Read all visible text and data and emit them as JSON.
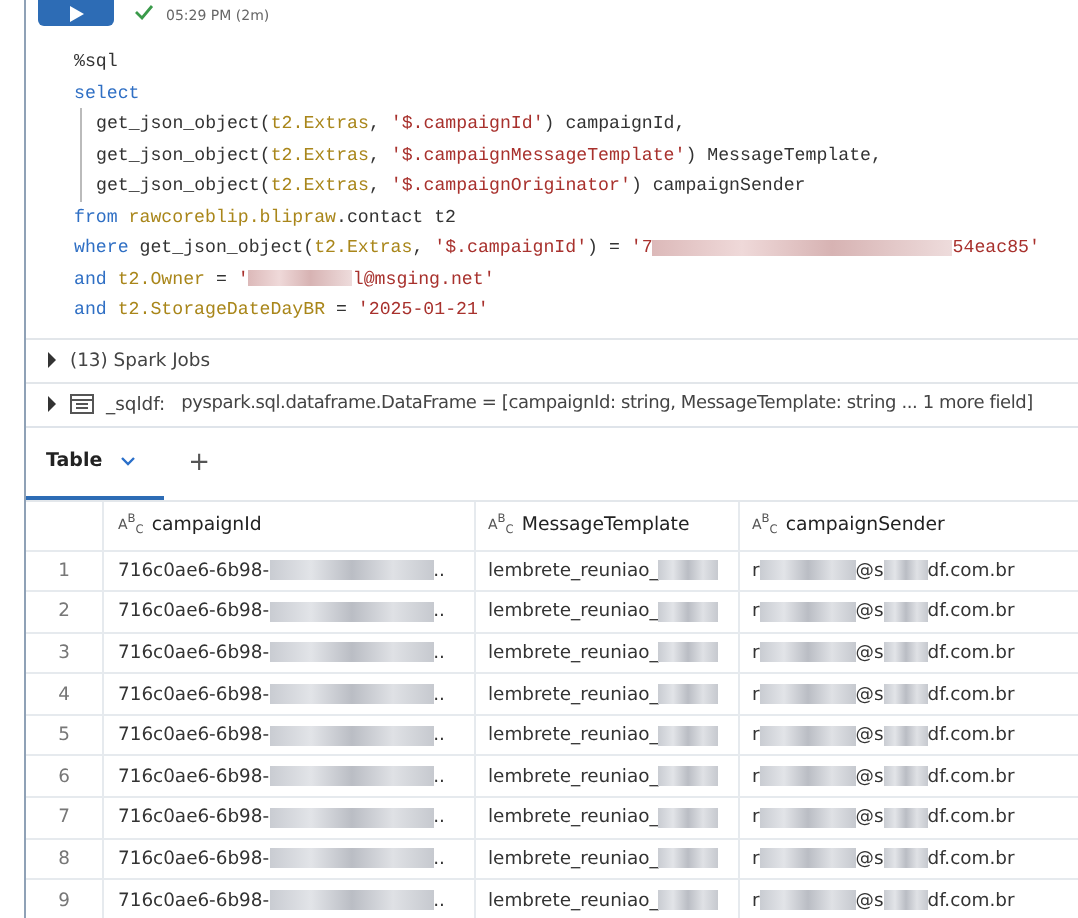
{
  "cell_header": {
    "status": "05:29 PM (2m)"
  },
  "code": [
    {
      "guide": false,
      "tokens": [
        {
          "kind": "plain",
          "s": "%sql"
        }
      ]
    },
    {
      "guide": false,
      "tokens": [
        {
          "kind": "kw",
          "s": "select"
        }
      ]
    },
    {
      "guide": true,
      "tokens": [
        {
          "kind": "plain",
          "s": "get_json_object("
        },
        {
          "kind": "ident",
          "s": "t2.Extras"
        },
        {
          "kind": "plain",
          "s": ", "
        },
        {
          "kind": "str",
          "s": "'$.campaignId'"
        },
        {
          "kind": "plain",
          "s": ") campaignId,"
        }
      ]
    },
    {
      "guide": true,
      "tokens": [
        {
          "kind": "plain",
          "s": "get_json_object("
        },
        {
          "kind": "ident",
          "s": "t2.Extras"
        },
        {
          "kind": "plain",
          "s": ", "
        },
        {
          "kind": "str",
          "s": "'$.campaignMessageTemplate'"
        },
        {
          "kind": "plain",
          "s": ") MessageTemplate,"
        }
      ]
    },
    {
      "guide": true,
      "tokens": [
        {
          "kind": "plain",
          "s": "get_json_object("
        },
        {
          "kind": "ident",
          "s": "t2.Extras"
        },
        {
          "kind": "plain",
          "s": ", "
        },
        {
          "kind": "str",
          "s": "'$.campaignOriginator'"
        },
        {
          "kind": "plain",
          "s": ") campaignSender"
        }
      ]
    },
    {
      "guide": false,
      "tokens": [
        {
          "kind": "kw",
          "s": "from "
        },
        {
          "kind": "ident",
          "s": "rawcoreblip.blipraw"
        },
        {
          "kind": "plain",
          "s": ".contact t2"
        }
      ]
    },
    {
      "guide": false,
      "tokens": [
        {
          "kind": "kw",
          "s": "where "
        },
        {
          "kind": "plain",
          "s": "get_json_object("
        },
        {
          "kind": "ident",
          "s": "t2.Extras"
        },
        {
          "kind": "plain",
          "s": ", "
        },
        {
          "kind": "str",
          "s": "'$.campaignId'"
        },
        {
          "kind": "plain",
          "s": ") = "
        },
        {
          "kind": "str",
          "s": "'7"
        },
        {
          "kind": "redacted"
        },
        {
          "kind": "str",
          "s": "54eac85'"
        }
      ]
    },
    {
      "guide": false,
      "tokens": [
        {
          "kind": "kw",
          "s": "and "
        },
        {
          "kind": "ident",
          "s": "t2.Owner"
        },
        {
          "kind": "plain",
          "s": " = "
        },
        {
          "kind": "str",
          "s": "'"
        },
        {
          "kind": "redacted"
        },
        {
          "kind": "str",
          "s": "l@msging.net'"
        }
      ]
    },
    {
      "guide": false,
      "tokens": [
        {
          "kind": "kw",
          "s": "and "
        },
        {
          "kind": "ident",
          "s": "t2.StorageDateDayBR"
        },
        {
          "kind": "plain",
          "s": " = "
        },
        {
          "kind": "str",
          "s": "'2025-01-21'"
        }
      ]
    }
  ],
  "spark_jobs": {
    "label": "(13) Spark Jobs",
    "expanded": false
  },
  "dataframe": {
    "name": "_sqldf:",
    "schema": "pyspark.sql.dataframe.DataFrame = [campaignId: string, MessageTemplate: string ... 1 more field]",
    "expanded": false
  },
  "tabs": [
    {
      "label": "Table",
      "selected": true
    }
  ],
  "add_tab": "+",
  "table": {
    "columns": [
      {
        "type": "A$^{B}$$_{C}$",
        "name": "campaignId"
      },
      {
        "type": "A$^{B}$$_{C}$",
        "name": "MessageTemplate"
      },
      {
        "type": "A$^{B}$$_{C}$",
        "name": "campaignSender"
      }
    ],
    "rows": [
      {
        "index": "1",
        "cells": [
          [
            {
              "kind": "text",
              "s": "716c0ae6-6b98-"
            },
            {
              "kind": "redacted"
            },
            {
              "kind": "text",
              "s": ".."
            }
          ],
          [
            {
              "kind": "text",
              "s": "lembrete_reuniao_"
            },
            {
              "kind": "redacted"
            }
          ],
          [
            {
              "kind": "text",
              "s": "r"
            },
            {
              "kind": "redacted"
            },
            {
              "kind": "text",
              "s": "@s"
            },
            {
              "kind": "redacted"
            },
            {
              "kind": "text",
              "s": "df.com.br"
            }
          ]
        ]
      },
      {
        "index": "2",
        "cells": [
          [
            {
              "kind": "text",
              "s": "716c0ae6-6b98-"
            },
            {
              "kind": "redacted"
            },
            {
              "kind": "text",
              "s": ".."
            }
          ],
          [
            {
              "kind": "text",
              "s": "lembrete_reuniao_"
            },
            {
              "kind": "redacted"
            }
          ],
          [
            {
              "kind": "text",
              "s": "r"
            },
            {
              "kind": "redacted"
            },
            {
              "kind": "text",
              "s": "@s"
            },
            {
              "kind": "redacted"
            },
            {
              "kind": "text",
              "s": "df.com.br"
            }
          ]
        ]
      },
      {
        "index": "3",
        "cells": [
          [
            {
              "kind": "text",
              "s": "716c0ae6-6b98-"
            },
            {
              "kind": "redacted"
            },
            {
              "kind": "text",
              "s": ".."
            }
          ],
          [
            {
              "kind": "text",
              "s": "lembrete_reuniao_"
            },
            {
              "kind": "redacted"
            }
          ],
          [
            {
              "kind": "text",
              "s": "r"
            },
            {
              "kind": "redacted"
            },
            {
              "kind": "text",
              "s": "@s"
            },
            {
              "kind": "redacted"
            },
            {
              "kind": "text",
              "s": "df.com.br"
            }
          ]
        ]
      },
      {
        "index": "4",
        "cells": [
          [
            {
              "kind": "text",
              "s": "716c0ae6-6b98-"
            },
            {
              "kind": "redacted"
            },
            {
              "kind": "text",
              "s": ".."
            }
          ],
          [
            {
              "kind": "text",
              "s": "lembrete_reuniao_"
            },
            {
              "kind": "redacted"
            }
          ],
          [
            {
              "kind": "text",
              "s": "r"
            },
            {
              "kind": "redacted"
            },
            {
              "kind": "text",
              "s": "@s"
            },
            {
              "kind": "redacted"
            },
            {
              "kind": "text",
              "s": "df.com.br"
            }
          ]
        ]
      },
      {
        "index": "5",
        "cells": [
          [
            {
              "kind": "text",
              "s": "716c0ae6-6b98-"
            },
            {
              "kind": "redacted"
            },
            {
              "kind": "text",
              "s": ".."
            }
          ],
          [
            {
              "kind": "text",
              "s": "lembrete_reuniao_"
            },
            {
              "kind": "redacted"
            }
          ],
          [
            {
              "kind": "text",
              "s": "r"
            },
            {
              "kind": "redacted"
            },
            {
              "kind": "text",
              "s": "@s"
            },
            {
              "kind": "redacted"
            },
            {
              "kind": "text",
              "s": "df.com.br"
            }
          ]
        ]
      },
      {
        "index": "6",
        "cells": [
          [
            {
              "kind": "text",
              "s": "716c0ae6-6b98-"
            },
            {
              "kind": "redacted"
            },
            {
              "kind": "text",
              "s": ".."
            }
          ],
          [
            {
              "kind": "text",
              "s": "lembrete_reuniao_"
            },
            {
              "kind": "redacted"
            }
          ],
          [
            {
              "kind": "text",
              "s": "r"
            },
            {
              "kind": "redacted"
            },
            {
              "kind": "text",
              "s": "@s"
            },
            {
              "kind": "redacted"
            },
            {
              "kind": "text",
              "s": "df.com.br"
            }
          ]
        ]
      },
      {
        "index": "7",
        "cells": [
          [
            {
              "kind": "text",
              "s": "716c0ae6-6b98-"
            },
            {
              "kind": "redacted"
            },
            {
              "kind": "text",
              "s": ".."
            }
          ],
          [
            {
              "kind": "text",
              "s": "lembrete_reuniao_"
            },
            {
              "kind": "redacted"
            }
          ],
          [
            {
              "kind": "text",
              "s": "r"
            },
            {
              "kind": "redacted"
            },
            {
              "kind": "text",
              "s": "@s"
            },
            {
              "kind": "redacted"
            },
            {
              "kind": "text",
              "s": "df.com.br"
            }
          ]
        ]
      },
      {
        "index": "8",
        "cells": [
          [
            {
              "kind": "text",
              "s": "716c0ae6-6b98-"
            },
            {
              "kind": "redacted"
            },
            {
              "kind": "text",
              "s": ".."
            }
          ],
          [
            {
              "kind": "text",
              "s": "lembrete_reuniao_"
            },
            {
              "kind": "redacted"
            }
          ],
          [
            {
              "kind": "text",
              "s": "r"
            },
            {
              "kind": "redacted"
            },
            {
              "kind": "text",
              "s": "@s"
            },
            {
              "kind": "redacted"
            },
            {
              "kind": "text",
              "s": "df.com.br"
            }
          ]
        ]
      },
      {
        "index": "9",
        "cells": [
          [
            {
              "kind": "text",
              "s": "716c0ae6-6b98-"
            },
            {
              "kind": "redacted"
            },
            {
              "kind": "text",
              "s": ".."
            }
          ],
          [
            {
              "kind": "text",
              "s": "lembrete_reuniao_"
            },
            {
              "kind": "redacted"
            }
          ],
          [
            {
              "kind": "text",
              "s": "r"
            },
            {
              "kind": "redacted"
            },
            {
              "kind": "text",
              "s": "@s"
            },
            {
              "kind": "redacted"
            },
            {
              "kind": "text",
              "s": "df.com.br"
            }
          ]
        ]
      }
    ]
  }
}
